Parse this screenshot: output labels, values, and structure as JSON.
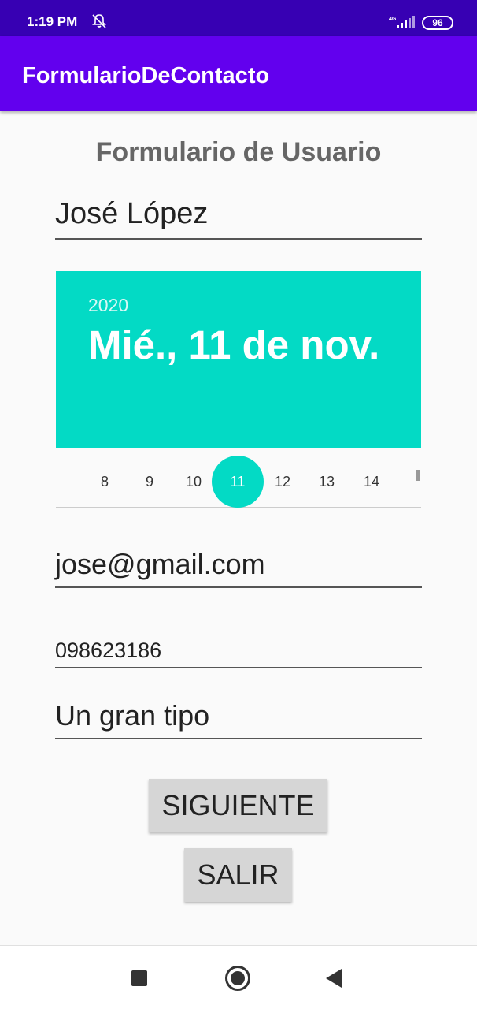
{
  "status_bar": {
    "time": "1:19 PM",
    "network": "4G",
    "battery": "96"
  },
  "app_bar": {
    "title": "FormularioDeContacto"
  },
  "form": {
    "title": "Formulario de Usuario",
    "name_value": "José López",
    "email_value": "jose@gmail.com",
    "phone_value": "098623186",
    "description_value": "Un gran tipo"
  },
  "date_picker": {
    "year": "2020",
    "date_label": "Mié., 11 de nov.",
    "days": [
      "8",
      "9",
      "10",
      "11",
      "12",
      "13",
      "14"
    ],
    "selected_day": "11"
  },
  "buttons": {
    "next": "SIGUIENTE",
    "exit": "SALIR"
  },
  "colors": {
    "status_bar": "#3700b3",
    "app_bar": "#6200ee",
    "accent": "#03dac5"
  },
  "icons": [
    "bell-off-icon",
    "signal-icon",
    "battery-icon",
    "recents-icon",
    "home-icon",
    "back-icon"
  ]
}
